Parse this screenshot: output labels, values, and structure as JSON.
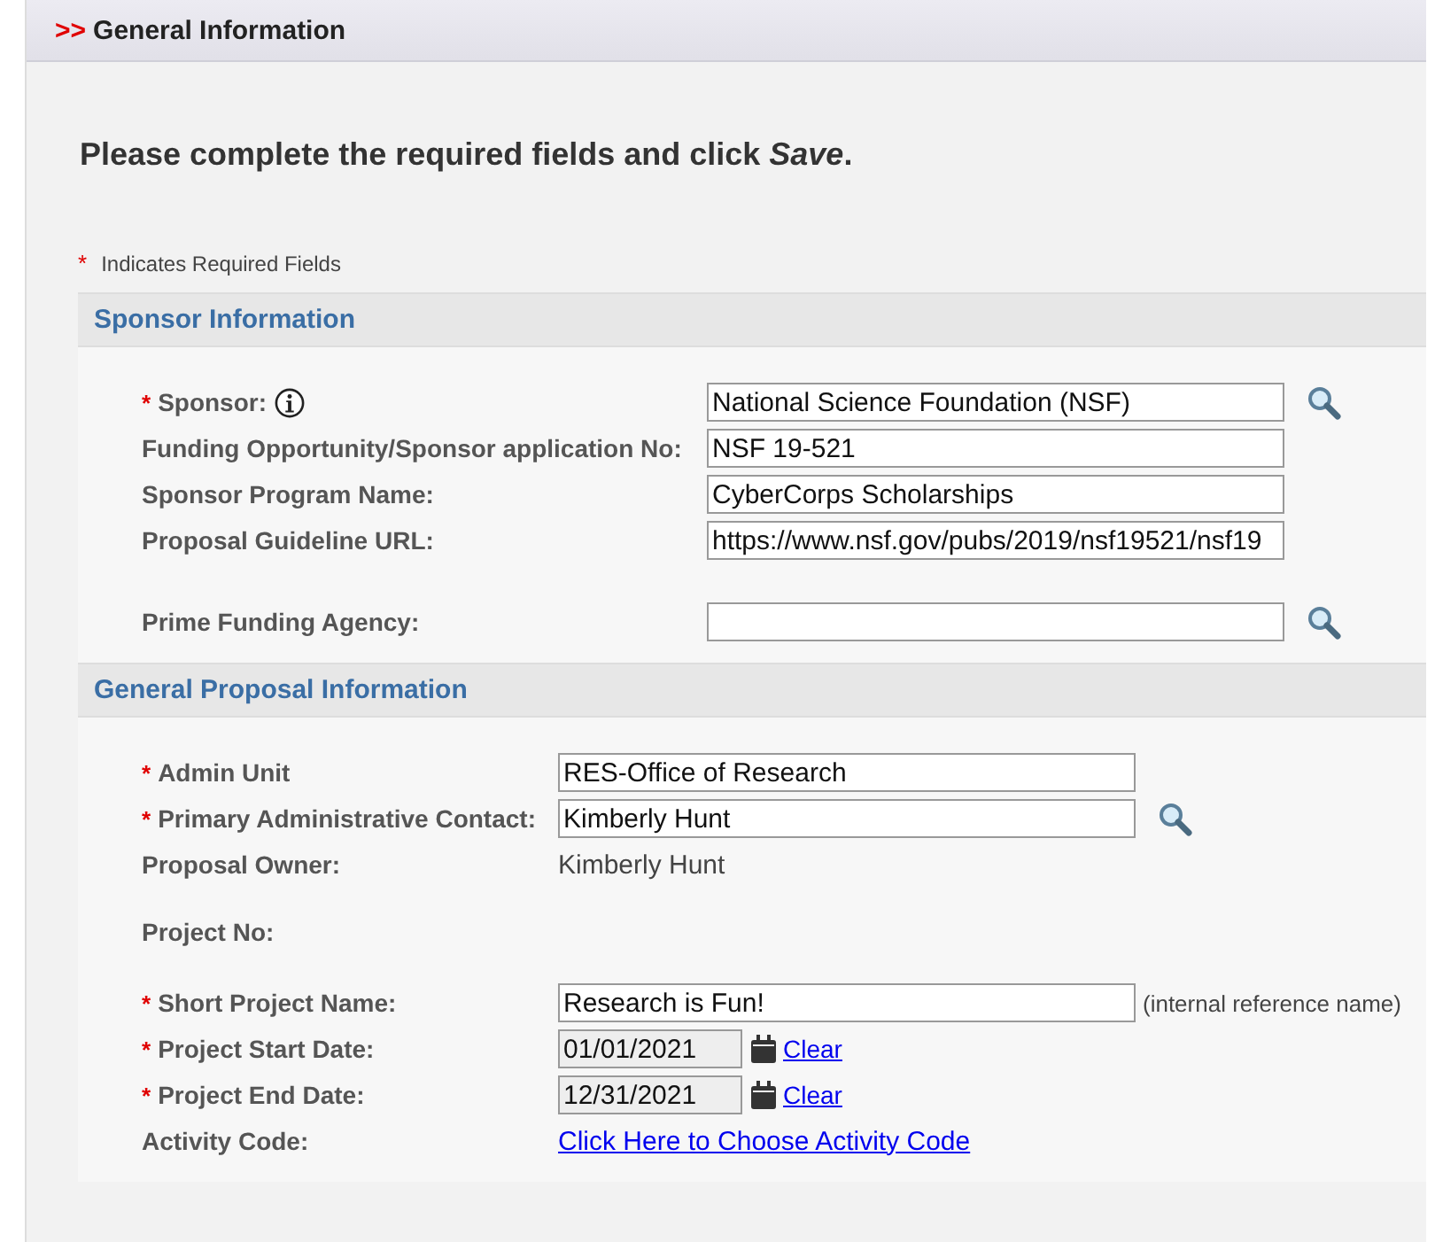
{
  "header": {
    "marker": ">>",
    "title": "General Information"
  },
  "instruction": "Please complete the required fields and click *Save*.",
  "legend": {
    "mark": "*",
    "text": "Indicates Required Fields"
  },
  "sections": [
    {
      "title": "Sponsor Information",
      "rows": [
        {
          "required_mark": "*",
          "label": "Sponsor:",
          "info": true,
          "kind": "input",
          "value": "National Science Foundation (NSF)",
          "lookup": true
        },
        {
          "label": "Funding Opportunity/Sponsor application No:",
          "kind": "input",
          "value": "NSF 19-521"
        },
        {
          "label": "Sponsor Program Name:",
          "kind": "input",
          "value": "CyberCorps Scholarships"
        },
        {
          "label": "Proposal Guideline URL:",
          "kind": "input",
          "value": "https://www.nsf.gov/pubs/2019/nsf19521/nsf19"
        },
        {
          "label": "Prime Funding Agency:",
          "kind": "input",
          "value": "",
          "lookup": true
        }
      ]
    },
    {
      "title": "General Proposal Information",
      "rows": [
        {
          "required_mark": "*",
          "label": "Admin Unit",
          "kind": "input",
          "value": "RES-Office of Research"
        },
        {
          "required_mark": "*",
          "label": "Primary Administrative Contact:",
          "kind": "input",
          "value": "Kimberly Hunt",
          "lookup": true
        },
        {
          "label": "Proposal Owner:",
          "kind": "text",
          "value": "Kimberly Hunt"
        },
        {
          "label": "Project No:",
          "kind": "text",
          "value": ""
        },
        {
          "required_mark": "*",
          "label": "Short Project Name:",
          "kind": "input",
          "value": "Research is Fun!",
          "note": "(internal reference name)"
        },
        {
          "required_mark": "*",
          "label": "Project Start Date:",
          "kind": "date",
          "value": "01/01/2021",
          "action": "Clear"
        },
        {
          "required_mark": "*",
          "label": "Project End Date:",
          "kind": "date",
          "value": "12/31/2021",
          "action": "Clear"
        },
        {
          "label": "Activity Code:",
          "kind": "link",
          "value": "Click Here to Choose Activity Code"
        }
      ]
    }
  ]
}
